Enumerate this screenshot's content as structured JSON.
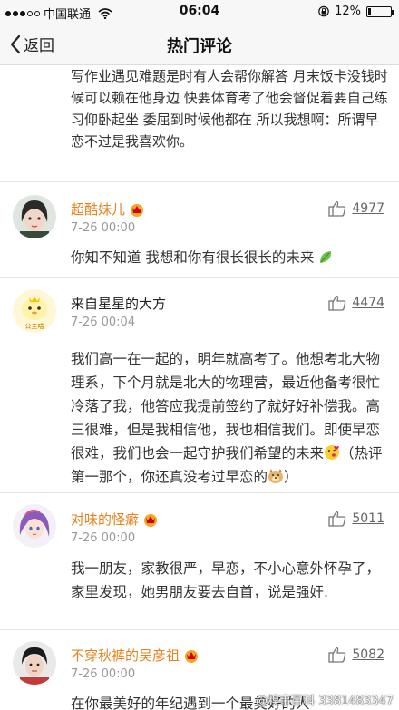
{
  "status_bar": {
    "carrier": "中国联通",
    "time": "06:04",
    "battery": "12%",
    "battery_level": 0.12
  },
  "nav": {
    "back_label": "返回",
    "title": "热门评论"
  },
  "top_text": "写作业遇见难题是时有人会帮你解答 月末饭卡没钱时候可以赖在他身边 快要体育考了他会督促着要自己练习仰卧起坐 委屈到时候他都在 所以我想啊：所谓早恋不过是我喜欢你。",
  "comments": [
    {
      "name": "超酷妹儿",
      "time": "7-26 00:00",
      "likes": "4977",
      "body": "你知不知道 我想和你有很长很长的未来"
    },
    {
      "name": "来自星星的大方",
      "time": "7-26 00:04",
      "likes": "4474",
      "avatar_text": "公主喵",
      "body_a": "我们高一在一起的，明年就高考了。他想考北大物理系，下个月就是北大的物理营，最近他备考很忙冷落了我，他答应我提前签约了就好好补偿我。高三很难，但是我相信他，我也相信我们。即使早恋很难，我们也会一起守护我们希望的未来",
      "body_b": "（热评第一那个，你还真没考过早恋的",
      "body_c": "）"
    },
    {
      "name": "对味的怪癖",
      "time": "7-26 00:00",
      "likes": "5011",
      "body": "我一朋友，家教很严，早恋，不小心意外怀孕了，家里发现，她男朋友要去自首，说是强奸."
    },
    {
      "name": "不穿秋裤的吴彦祖",
      "time": "7-26 00:00",
      "likes": "5082",
      "body": "在你最美好的年纪遇到一个最美好的人"
    }
  ],
  "watermark": "@糗事百科 3381483347",
  "colors": {
    "accent": "#e8821d",
    "bar_bg": "#f7f7f7"
  }
}
